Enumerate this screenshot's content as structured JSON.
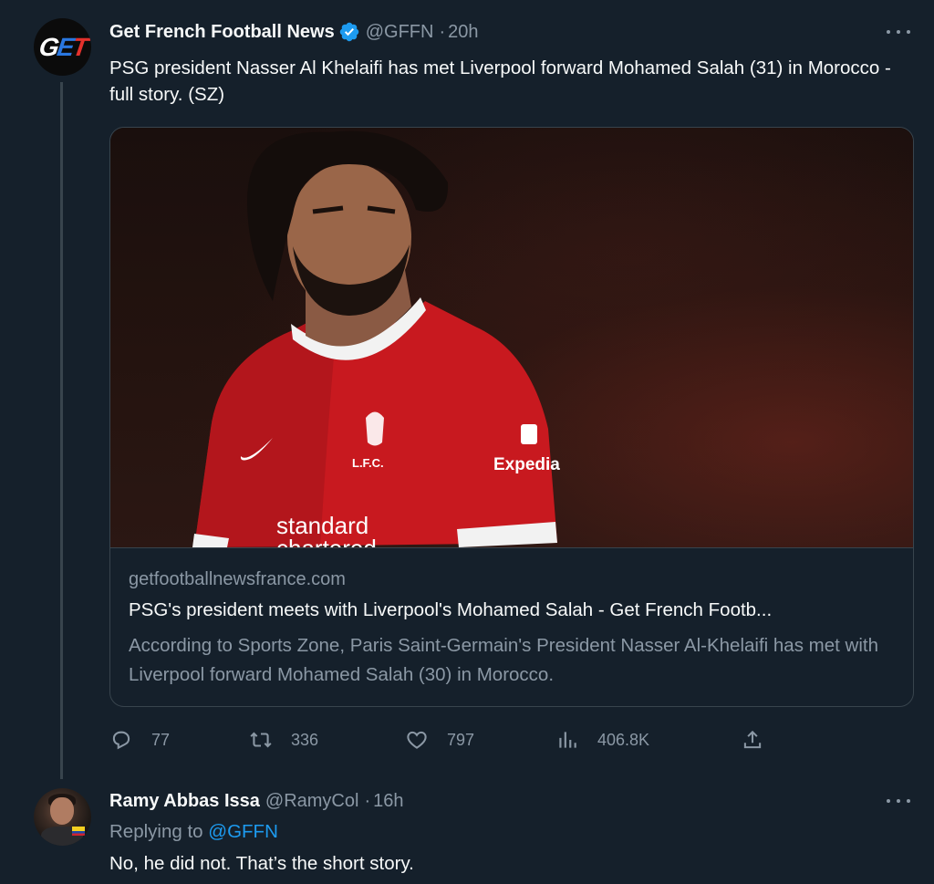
{
  "tweet": {
    "author_name": "Get French Football News",
    "handle": "@GFFN",
    "separator": "·",
    "time": "20h",
    "text": "PSG president Nasser Al Khelaifi has met Liverpool forward Mohamed Salah (31) in Morocco - full story. (SZ)",
    "avatar_logo": {
      "g": "G",
      "e": "E",
      "t": "T"
    },
    "card": {
      "domain": "getfootballnewsfrance.com",
      "title": "PSG's president meets with Liverpool's Mohamed Salah - Get French Footb...",
      "description": "According to Sports Zone, Paris Saint-Germain's President Nasser Al-Khelaifi has met with Liverpool forward Mohamed Salah (30) in Morocco.",
      "image_text": {
        "club": "L.F.C.",
        "sponsor_line1": "standard",
        "sponsor_line2": "chartered",
        "sleeve": "Expedia"
      }
    },
    "actions": {
      "replies": "77",
      "retweets": "336",
      "likes": "797",
      "views": "406.8K"
    }
  },
  "reply": {
    "author_name": "Ramy Abbas Issa",
    "handle": "@RamyCol",
    "separator": "·",
    "time": "16h",
    "replying_prefix": "Replying to",
    "replying_to": "@GFFN",
    "text": "No, he did not. That’s the short story."
  },
  "icons": {
    "more": "more-icon",
    "verified": "verified-badge-icon",
    "reply": "reply-icon",
    "retweet": "retweet-icon",
    "like": "heart-icon",
    "views": "views-icon",
    "share": "share-icon"
  },
  "colors": {
    "background": "#15202b",
    "text": "#f7f9f9",
    "muted": "#8b98a5",
    "accent": "#1d9bf0",
    "border": "#38444d"
  }
}
